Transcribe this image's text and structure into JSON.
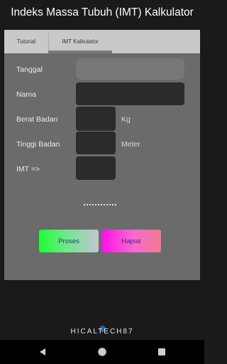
{
  "app": {
    "title": "Indeks Massa Tubuh (IMT) Kalkulator"
  },
  "tabs": [
    {
      "label": "Tutorial",
      "selected": false
    },
    {
      "label": "IMT Kalkulator",
      "selected": true
    }
  ],
  "form": {
    "tanggal": {
      "label": "Tanggal",
      "value": ""
    },
    "nama": {
      "label": "Nama",
      "value": ""
    },
    "berat": {
      "label": "Berat Badan",
      "value": "",
      "unit": "Kg"
    },
    "tinggi": {
      "label": "Tinggi Badan",
      "value": "",
      "unit": "Meter"
    },
    "imt": {
      "label": "IMT =>",
      "value": ""
    }
  },
  "buttons": {
    "proses": "Proses",
    "hapus": "Hapus"
  },
  "footer": {
    "brand": "HICALTECH87"
  },
  "navigation": {
    "back": "back-icon",
    "home": "home-icon",
    "recents": "recents-icon"
  },
  "colors": {
    "background": "#1a1a1a",
    "panel": "#6b6b6b",
    "tabbar": "#c9c9c9",
    "proses_gradient_start": "#1bff30",
    "hapus_gradient_start": "#ff10e8"
  }
}
